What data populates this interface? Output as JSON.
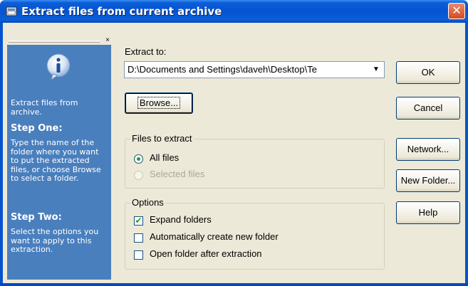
{
  "window": {
    "title": "Extract files from current archive",
    "close_glyph": "✕"
  },
  "help": {
    "close_glyph": "×",
    "intro": "Extract files from archive.",
    "step_one_heading": "Step One:",
    "step_one_text": "Type the name of the folder where you want to put the extracted files, or choose Browse to select a folder.",
    "step_two_heading": "Step Two:",
    "step_two_text": "Select the options you want to apply to this extraction."
  },
  "extract_to": {
    "label": "Extract to:",
    "value": "D:\\Documents and Settings\\daveh\\Desktop\\Te",
    "browse_button_label": "Browse..."
  },
  "files_to_extract": {
    "label": "Files to extract",
    "options": [
      {
        "label": "All files",
        "checked": true,
        "disabled": false
      },
      {
        "label": "Selected files",
        "checked": false,
        "disabled": true
      }
    ]
  },
  "options": {
    "label": "Options",
    "items": [
      {
        "label": "Expand folders",
        "checked": true
      },
      {
        "label": "Automatically create new folder",
        "checked": false
      },
      {
        "label": "Open folder after extraction",
        "checked": false
      }
    ]
  },
  "buttons": {
    "ok": "OK",
    "cancel": "Cancel",
    "network": "Network...",
    "new_folder": "New Folder...",
    "help": "Help"
  },
  "icons": {
    "title_icon": "archive-icon",
    "info_icon": "info-icon",
    "dropdown_icon": "chevron-down-icon",
    "check_glyph": "✔"
  }
}
